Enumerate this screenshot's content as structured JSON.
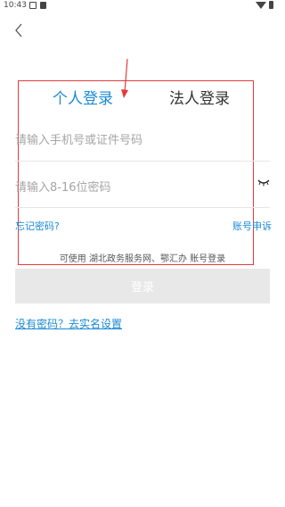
{
  "status_bar": {
    "time": "10:43"
  },
  "tabs": [
    {
      "label": "个人登录",
      "active": true
    },
    {
      "label": "法人登录",
      "active": false
    }
  ],
  "form": {
    "phone_placeholder": "请输入手机号或证件号码",
    "password_placeholder": "请输入8-16位密码"
  },
  "links": {
    "forgot_password": "忘记密码?",
    "account_appeal": "账号申诉"
  },
  "hint": "可使用 湖北政务服务网、鄂汇办 账号登录",
  "login_button": "登录",
  "set_password_link": "没有密码？去实名设置",
  "colors": {
    "accent": "#1a8ad5",
    "annotation": "#e33b3b",
    "disabled_button": "#e8e8e8"
  }
}
